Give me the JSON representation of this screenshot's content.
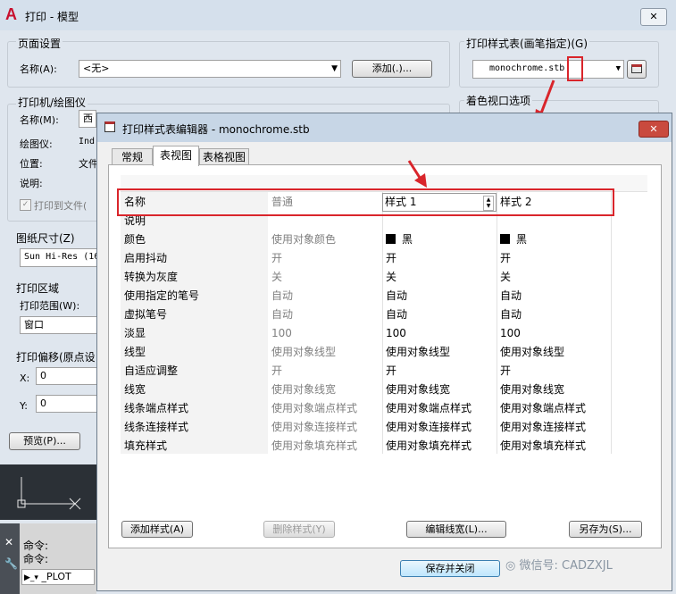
{
  "window": {
    "title": "打印 - 模型",
    "close_glyph": "✕"
  },
  "page_setup": {
    "group_label": "页面设置",
    "name_label": "名称(A):",
    "name_value": "<无>",
    "add_button": "添加(.)..."
  },
  "plot_style_table": {
    "group_label": "打印样式表(画笔指定)(G)",
    "value": "monochrome.stb"
  },
  "shaded_viewport": {
    "group_label": "着色视口选项"
  },
  "printer": {
    "group_label": "打印机/绘图仪",
    "name_label": "名称(M):",
    "name_value": "西",
    "plotter_label": "绘图仪:",
    "plotter_value": "Ind",
    "location_label": "位置:",
    "location_value": "文件",
    "desc_label": "说明:",
    "print_to_file": "打印到文件("
  },
  "paper_size": {
    "group_label": "图纸尺寸(Z)",
    "value": "Sun Hi-Res (16"
  },
  "plot_area": {
    "group_label": "打印区域",
    "range_label": "打印范围(W):",
    "range_value": "窗口"
  },
  "plot_offset": {
    "group_label": "打印偏移(原点设",
    "x_label": "X:",
    "x_value": "0",
    "y_label": "Y:",
    "y_value": "0"
  },
  "preview_button": "预览(P)...",
  "command": {
    "line1": "命令:",
    "line2": "命令:",
    "input_value": "_PLOT"
  },
  "editor": {
    "title": "打印样式表编辑器 - monochrome.stb",
    "tabs": [
      "常规",
      "表视图",
      "表格视图"
    ],
    "name_header": "名称",
    "columns": [
      "普通",
      "样式 1",
      "样式 2"
    ],
    "rows": [
      {
        "label": "说明",
        "values": [
          "",
          "",
          ""
        ]
      },
      {
        "label": "颜色",
        "values": [
          "使用对象颜色",
          "黑",
          "黑"
        ]
      },
      {
        "label": "启用抖动",
        "values": [
          "开",
          "开",
          "开"
        ]
      },
      {
        "label": "转换为灰度",
        "values": [
          "关",
          "关",
          "关"
        ]
      },
      {
        "label": "使用指定的笔号",
        "values": [
          "自动",
          "自动",
          "自动"
        ]
      },
      {
        "label": "虚拟笔号",
        "values": [
          "自动",
          "自动",
          "自动"
        ]
      },
      {
        "label": "淡显",
        "values": [
          "100",
          "100",
          "100"
        ]
      },
      {
        "label": "线型",
        "values": [
          "使用对象线型",
          "使用对象线型",
          "使用对象线型"
        ]
      },
      {
        "label": "自适应调整",
        "values": [
          "开",
          "开",
          "开"
        ]
      },
      {
        "label": "线宽",
        "values": [
          "使用对象线宽",
          "使用对象线宽",
          "使用对象线宽"
        ]
      },
      {
        "label": "线条端点样式",
        "values": [
          "使用对象端点样式",
          "使用对象端点样式",
          "使用对象端点样式"
        ]
      },
      {
        "label": "线条连接样式",
        "values": [
          "使用对象连接样式",
          "使用对象连接样式",
          "使用对象连接样式"
        ]
      },
      {
        "label": "填充样式",
        "values": [
          "使用对象填充样式",
          "使用对象填充样式",
          "使用对象填充样式"
        ]
      }
    ],
    "buttons": {
      "add_style": "添加样式(A)",
      "delete_style": "删除样式(Y)",
      "edit_lineweight": "编辑线宽(L)...",
      "save_as": "另存为(S)...",
      "save_close": "保存并关闭"
    }
  },
  "watermark": "微信号: CADZXJL",
  "colors": {
    "highlight": "#d9252b",
    "title_bar": "#c7d6e6",
    "close_red": "#c94a3e"
  }
}
